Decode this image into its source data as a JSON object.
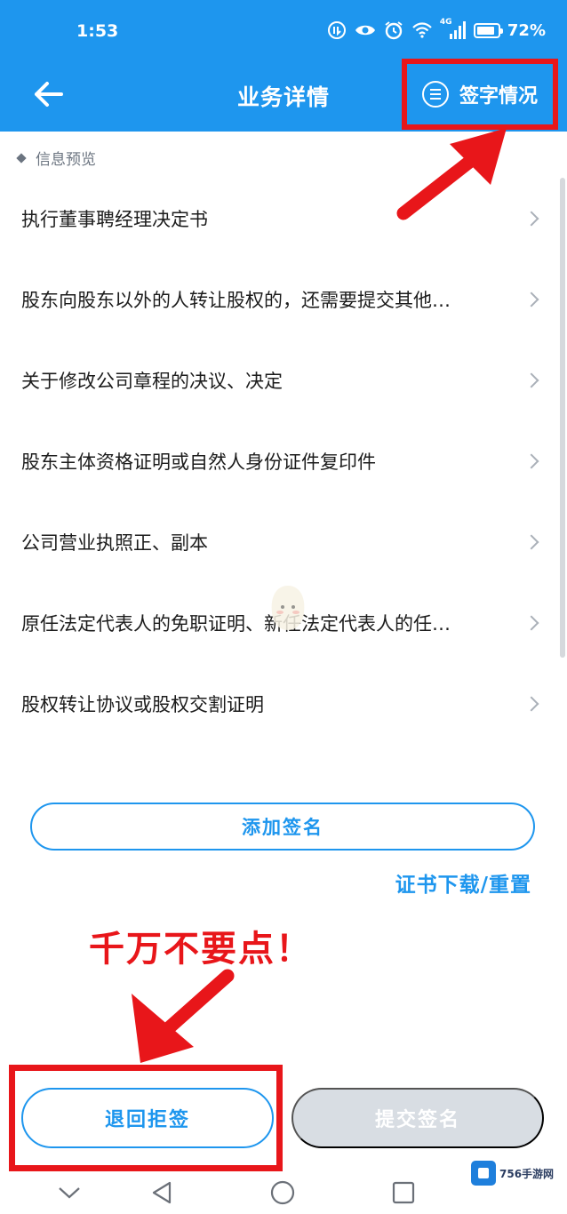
{
  "status_bar": {
    "time": "1:53",
    "battery": "72%",
    "network": "4G"
  },
  "header": {
    "title": "业务详情",
    "sign_status_label": "签字情况"
  },
  "section": {
    "title": "信息预览"
  },
  "documents": [
    "执行董事聘经理决定书",
    "股东向股东以外的人转让股权的，还需要提交其他…",
    "关于修改公司章程的决议、决定",
    "股东主体资格证明或自然人身份证件复印件",
    "公司营业执照正、副本",
    "原任法定代表人的免职证明、新任法定代表人的任…",
    "股权转让协议或股权交割证明"
  ],
  "actions": {
    "add_signature": "添加签名",
    "cert_download": "证书下载/重置",
    "reject": "退回拒签",
    "submit": "提交签名"
  },
  "annotation": {
    "warning": "千万不要点！"
  },
  "watermark": {
    "brand": "756手游网"
  },
  "colors": {
    "primary": "#1e96ee",
    "annotation_red": "#e8161a",
    "disabled": "#d8dde3"
  }
}
